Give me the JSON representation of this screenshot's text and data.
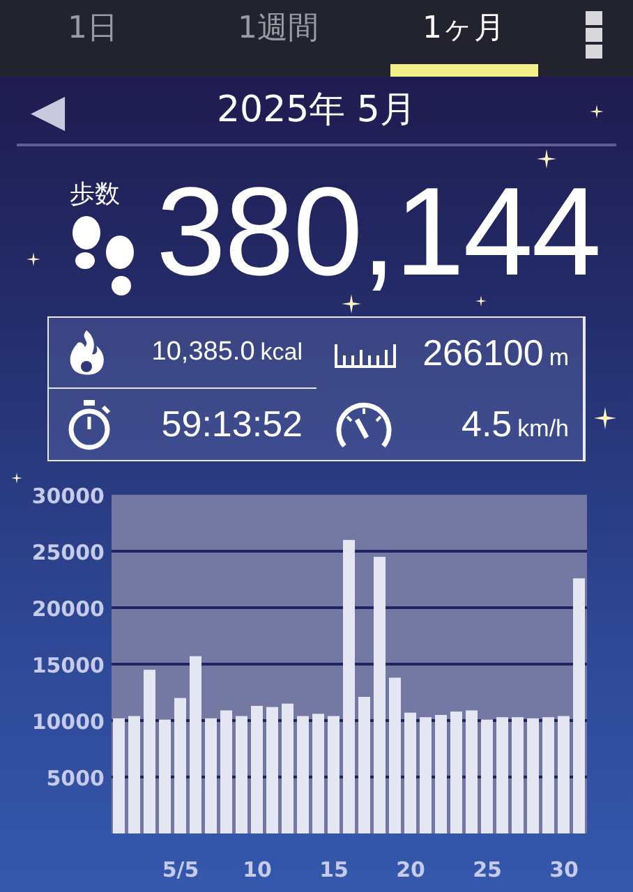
{
  "tabs": [
    {
      "label": "1日",
      "selected": false
    },
    {
      "label": "1週間",
      "selected": false
    },
    {
      "label": "1ヶ月",
      "selected": true
    }
  ],
  "header": {
    "back": "◀",
    "title": "2025年 5月"
  },
  "steps": {
    "label": "歩数",
    "value": "380,144"
  },
  "stats": [
    {
      "kind": "calories",
      "value": "10,385.0",
      "unit": "kcal"
    },
    {
      "kind": "distance",
      "value": "266100",
      "unit": "m"
    },
    {
      "kind": "time",
      "value": "59:13:52"
    },
    {
      "kind": "speed",
      "value": "4.5",
      "unit": "km/h"
    }
  ],
  "chart": {
    "chart_data": {
      "type": "bar",
      "x": [
        "2025-05-01",
        "2025-05-02",
        "2025-05-03",
        "2025-05-04",
        "2025-05-05",
        "2025-05-06",
        "2025-05-07",
        "2025-05-08",
        "2025-05-09",
        "2025-05-10",
        "2025-05-11",
        "2025-05-12",
        "2025-05-13",
        "2025-05-14",
        "2025-05-15",
        "2025-05-16",
        "2025-05-17",
        "2025-05-18",
        "2025-05-19",
        "2025-05-20",
        "2025-05-21",
        "2025-05-22",
        "2025-05-23",
        "2025-05-24",
        "2025-05-25",
        "2025-05-26",
        "2025-05-27",
        "2025-05-28",
        "2025-05-29",
        "2025-05-30",
        "2025-05-31"
      ],
      "values": [
        10200,
        10400,
        14500,
        10100,
        12000,
        15700,
        10200,
        10900,
        10400,
        11300,
        11200,
        11500,
        10400,
        10600,
        10400,
        26000,
        12100,
        24500,
        13800,
        10700,
        10300,
        10500,
        10800,
        10900,
        10100,
        10300,
        10300,
        10200,
        10300,
        10400,
        22600
      ],
      "xlim": [
        "2025-05-01",
        "2025-05-31"
      ],
      "grid": true,
      "ylim": [
        0,
        30000
      ],
      "yticks": [
        5000,
        10000,
        15000,
        20000,
        25000,
        30000
      ],
      "xticks": [
        {
          "value": "2025-05-05",
          "label": "5/5"
        },
        {
          "value": "2025-05-10",
          "label": "10"
        },
        {
          "value": "2025-05-15",
          "label": "15"
        },
        {
          "value": "2025-05-20",
          "label": "20"
        },
        {
          "value": "2025-05-25",
          "label": "25"
        },
        {
          "value": "2025-05-30",
          "label": "30"
        }
      ]
    }
  }
}
